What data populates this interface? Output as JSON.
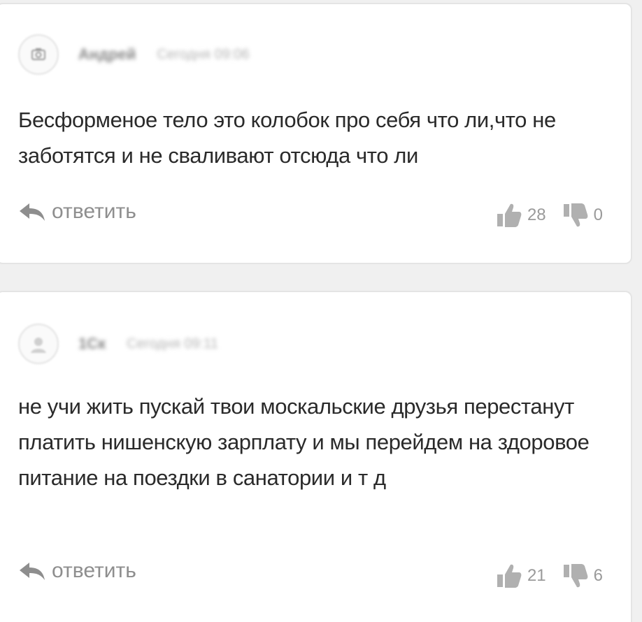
{
  "comments": [
    {
      "author": "Андрей",
      "time": "Сегодня 09:06",
      "text": "Бесформеное тело это колобок про себя что ли,что не заботятся и не сваливают отсюда что ли",
      "reply_label": "ответить",
      "likes": "28",
      "dislikes": "0"
    },
    {
      "author": "1Ск",
      "time": "Сегодня 09:11",
      "text": "не учи жить пускай твои москальские друзья перестанут платить нишенскую зарплату и мы перейдем на здоровое питание на поездки в санатории и т д",
      "reply_label": "ответить",
      "likes": "21",
      "dislikes": "6"
    }
  ],
  "icons": {
    "avatar": "camera-icon",
    "reply": "reply-arrow-icon",
    "like": "thumbs-up-icon",
    "dislike": "thumbs-down-icon"
  },
  "colors": {
    "card_bg": "#ffffff",
    "page_bg": "#f0f0f0",
    "text": "#2a2a2a",
    "muted": "#8e8e8e"
  }
}
